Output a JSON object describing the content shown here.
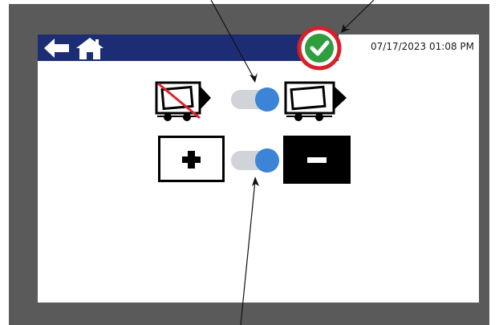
{
  "header": {
    "timestamp": "07/17/2023 01:08 PM",
    "back_icon": "back-arrow-icon",
    "home_icon": "home-icon",
    "status_icon": "check-circle-icon"
  },
  "controls": {
    "conveyor_toggle": {
      "left_icon": "tray-disabled-icon",
      "right_icon": "tray-enabled-icon",
      "state": "right"
    },
    "polarity_toggle": {
      "left_icon": "plus-icon",
      "right_icon": "minus-icon",
      "state": "right"
    }
  },
  "colors": {
    "topbar": "#1d2d73",
    "frame": "#5a5a5a",
    "toggle_knob": "#3c84d8",
    "toggle_track": "#d0d3d8",
    "status_check": "#2e9e3e",
    "status_ring": "#d9202a"
  }
}
